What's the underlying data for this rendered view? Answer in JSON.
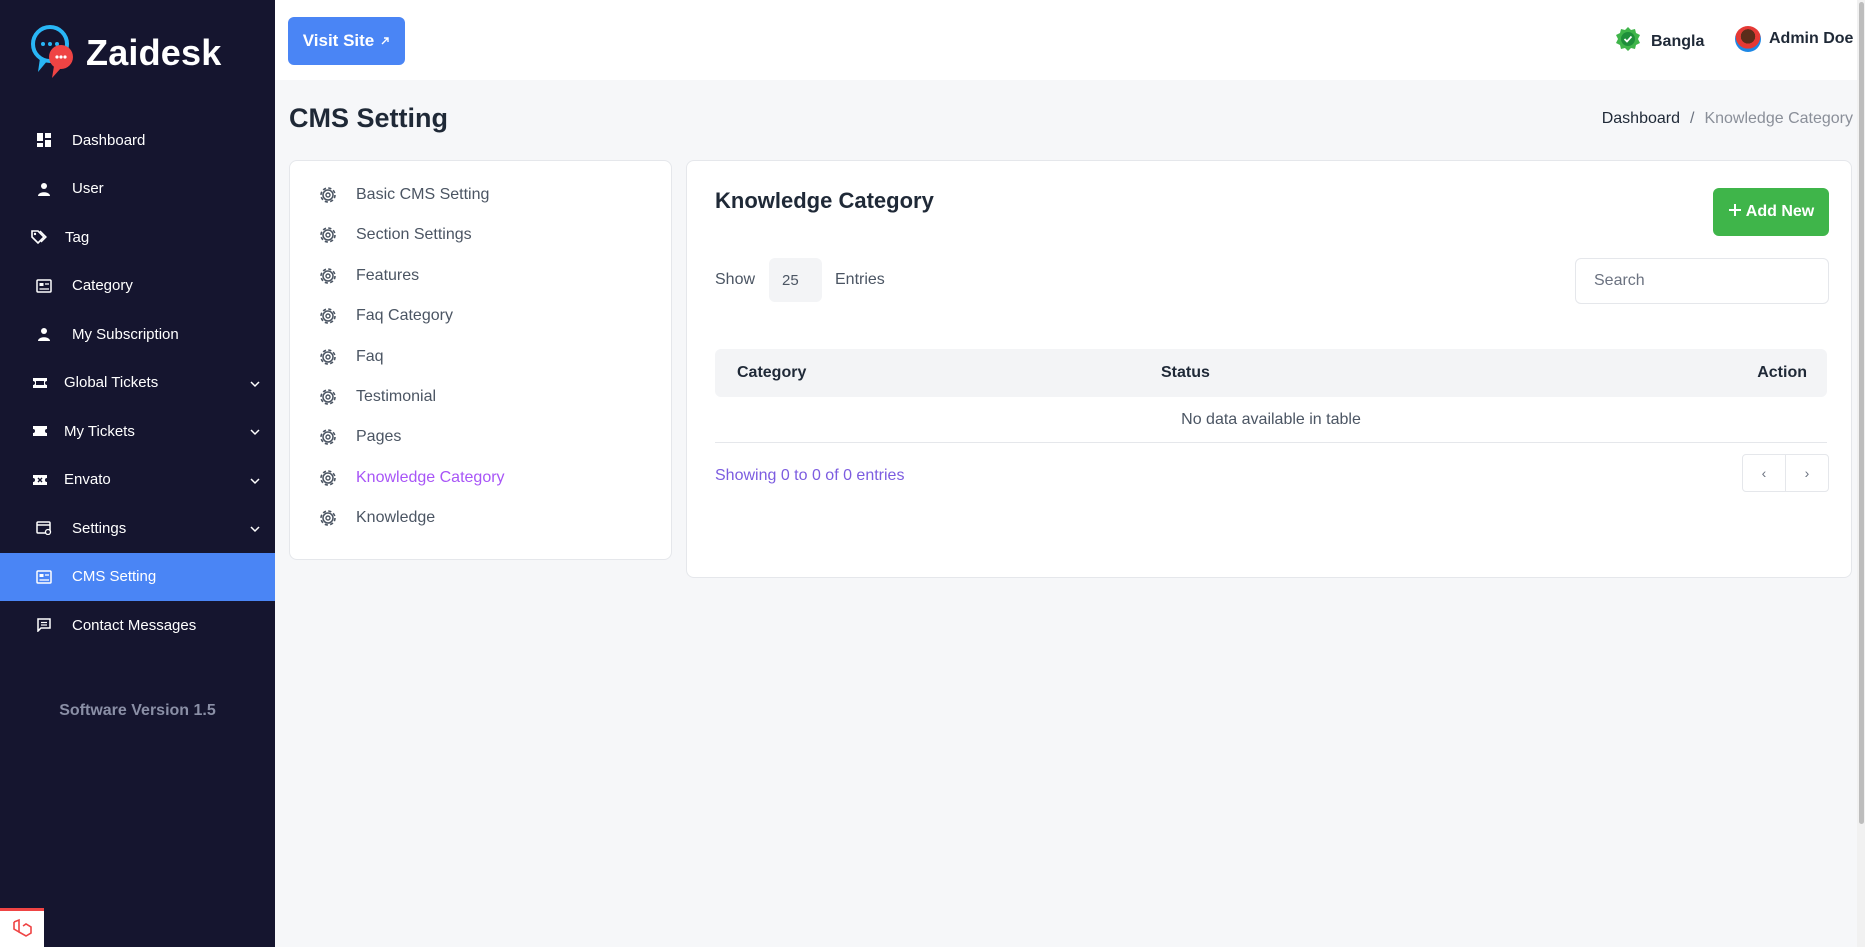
{
  "brand": {
    "name": "Zaidesk"
  },
  "sidebar": {
    "items": [
      {
        "label": "Dashboard",
        "icon": "dashboard-icon"
      },
      {
        "label": "User",
        "icon": "user-icon"
      },
      {
        "label": "Tag",
        "icon": "tag-icon"
      },
      {
        "label": "Category",
        "icon": "category-icon"
      },
      {
        "label": "My Subscription",
        "icon": "user-icon"
      },
      {
        "label": "Global Tickets",
        "icon": "ticket-icon",
        "expandable": true
      },
      {
        "label": "My Tickets",
        "icon": "ticket-icon",
        "expandable": true
      },
      {
        "label": "Envato",
        "icon": "envato-icon",
        "expandable": true
      },
      {
        "label": "Settings",
        "icon": "settings-window-icon",
        "expandable": true
      },
      {
        "label": "CMS Setting",
        "icon": "cms-icon",
        "active": true
      },
      {
        "label": "Contact Messages",
        "icon": "message-icon"
      }
    ],
    "version": "Software Version 1.5",
    "active_color": "#4a85f5",
    "background": "#15152f"
  },
  "topbar": {
    "visit_site": "Visit Site",
    "language": "Bangla",
    "user_name": "Admin Doe"
  },
  "page": {
    "title": "CMS Setting",
    "breadcrumb": {
      "home": "Dashboard",
      "separator": "/",
      "current": "Knowledge Category"
    }
  },
  "cms_menu": {
    "items": [
      {
        "label": "Basic CMS Setting"
      },
      {
        "label": "Section Settings"
      },
      {
        "label": "Features"
      },
      {
        "label": "Faq Category"
      },
      {
        "label": "Faq"
      },
      {
        "label": "Testimonial"
      },
      {
        "label": "Pages"
      },
      {
        "label": "Knowledge Category",
        "active": true
      },
      {
        "label": "Knowledge"
      }
    ],
    "active_color": "#a855f7"
  },
  "main": {
    "title": "Knowledge Category",
    "add_new": "Add New",
    "show_label": "Show",
    "entries_value": "25",
    "entries_label": "Entries",
    "search": {
      "placeholder": "Search",
      "value": ""
    },
    "table": {
      "columns": [
        "Category",
        "Status",
        "Action"
      ],
      "empty_message": "No data available in table"
    },
    "showing_text": "Showing 0 to 0 of 0 entries",
    "pager": {
      "prev": "‹",
      "next": "›"
    },
    "add_color": "#3fb54a"
  }
}
